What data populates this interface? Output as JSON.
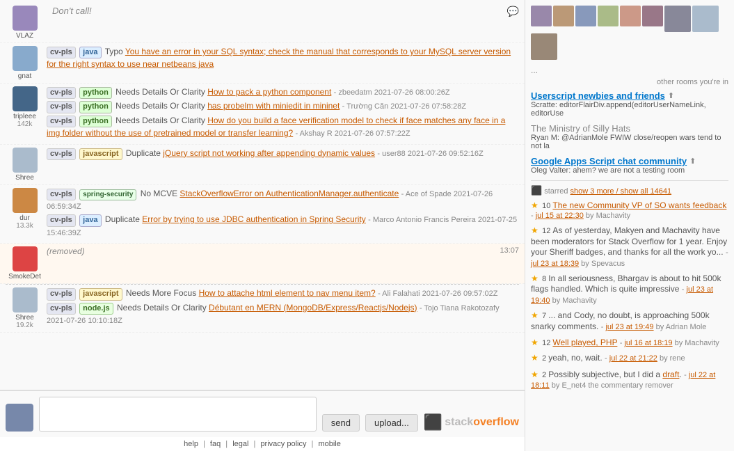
{
  "users": {
    "vlaz": {
      "name": "VLAZ",
      "status": "Don't call!"
    },
    "gnat": {
      "name": "gnat",
      "avatar_color": "#88aacc"
    },
    "tripleee": {
      "name": "tripleee",
      "rep": "142k",
      "avatar_color": "#446688"
    },
    "shree": {
      "name": "Shree",
      "avatar_color": "#aabbcc"
    },
    "dur": {
      "name": "dur",
      "rep": "13.3k",
      "avatar_color": "#cc8844"
    },
    "smokedet": {
      "name": "SmokeDet",
      "avatar_color": "#dd4444"
    },
    "shree2": {
      "name": "Shree",
      "rep": "19.2k",
      "avatar_color": "#aabbcc"
    }
  },
  "messages": [
    {
      "id": "m1",
      "user": "gnat",
      "tags": [
        {
          "type": "cvpls",
          "label": "cv-pls"
        },
        {
          "type": "java",
          "label": "java"
        }
      ],
      "reason": "Typo",
      "link_text": "You have an error in your SQL syntax; check the manual that corresponds to your MySQL server version for the right syntax to use near netbeans java",
      "link_url": "#",
      "meta": ""
    },
    {
      "id": "m2",
      "user": "tripleee",
      "tags": [
        {
          "type": "cvpls",
          "label": "cv-pls"
        },
        {
          "type": "python",
          "label": "python"
        }
      ],
      "reason": "Needs Details Or Clarity",
      "link_text": "How to pack a python component",
      "link_url": "#",
      "meta": "- zbeedatm 2021-07-26 08:00:26Z"
    },
    {
      "id": "m3",
      "user": "tripleee",
      "tags": [
        {
          "type": "cvpls",
          "label": "cv-pls"
        },
        {
          "type": "python",
          "label": "python"
        }
      ],
      "reason": "Needs Details Or Clarity",
      "link_text": "has probelm with miniedit in mininet",
      "link_url": "#",
      "meta": "- Trường Căn 2021-07-26 07:58:28Z"
    },
    {
      "id": "m4",
      "user": "tripleee",
      "tags": [
        {
          "type": "cvpls",
          "label": "cv-pls"
        },
        {
          "type": "python",
          "label": "python"
        }
      ],
      "reason": "Needs Details Or Clarity",
      "link_text": "How do you build a face verification model to check if face matches any face in a img folder without the use of pretrained model or transfer learning?",
      "link_url": "#",
      "meta": "- Akshay R 2021-07-26 07:57:22Z"
    },
    {
      "id": "m5",
      "user": "shree",
      "tags": [
        {
          "type": "cvpls",
          "label": "cv-pls"
        },
        {
          "type": "javascript",
          "label": "javascript"
        }
      ],
      "reason": "Duplicate",
      "link_text": "jQuery script not working after appending dynamic values",
      "link_url": "#",
      "meta": "- user88 2021-07-26 09:52:16Z"
    },
    {
      "id": "m6",
      "user": "dur",
      "tags": [
        {
          "type": "cvpls",
          "label": "cv-pls"
        },
        {
          "type": "spring",
          "label": "spring-security"
        }
      ],
      "reason": "No MCVE",
      "link_text": "StackOverflowError on AuthenticationManager.authenticate",
      "link_url": "#",
      "meta": "- Ace of Spade 2021-07-26 06:59:34Z"
    },
    {
      "id": "m7",
      "user": "dur",
      "tags": [
        {
          "type": "cvpls",
          "label": "cv-pls"
        },
        {
          "type": "java",
          "label": "java"
        }
      ],
      "reason": "Duplicate",
      "link_text": "Error by trying to use JDBC authentication in Spring Security",
      "link_url": "#",
      "meta": "- Marco Antonio Francis Pereira 2021-07-25 15:46:39Z"
    },
    {
      "id": "m8",
      "user": "smokedet",
      "removed": true,
      "removed_label": "(removed)",
      "time": "13:07"
    },
    {
      "id": "m9",
      "user": "shree2",
      "tags": [
        {
          "type": "cvpls",
          "label": "cv-pls"
        },
        {
          "type": "javascript",
          "label": "javascript"
        }
      ],
      "reason": "Needs More Focus",
      "link_text": "How to attache html element to nav menu item?",
      "link_url": "#",
      "meta": "- Ali Falahati 2021-07-26 09:57:02Z"
    },
    {
      "id": "m10",
      "user": "shree2",
      "tags": [
        {
          "type": "cvpls",
          "label": "cv-pls"
        },
        {
          "type": "nodejs",
          "label": "node.js"
        }
      ],
      "reason": "Needs Details Or Clarity",
      "link_text": "Débutant en MERN (MongoDB/Express/Reactjs/Nodejs)",
      "link_url": "#",
      "meta": "- Tojo Tiana Rakotozafy 2021-07-26 10:10:18Z"
    }
  ],
  "sidebar": {
    "ellipsis": "...",
    "other_rooms_label": "other rooms you're in",
    "rooms": [
      {
        "name": "Userscript newbies and friends",
        "has_expand": true,
        "desc": "Scratte: editorFlairDiv.append(editorUserNameLink, editorUse"
      },
      {
        "name": "The Ministry of Silly Hats",
        "has_expand": false,
        "desc": "Ryan M: @AdrianMole FWIW close/reopen wars tend to not la"
      },
      {
        "name": "Google Apps Script chat community",
        "has_expand": true,
        "desc": "Oleg Valter: ahem? we are not a testing room"
      }
    ],
    "starred": {
      "label": "starred",
      "show_more": "show 3 more / show all 14641",
      "items": [
        {
          "count": "10",
          "text": "The new Community VP of SO wants feedback",
          "meta": "jul 15 at 22:30 by Machavity"
        },
        {
          "count": "12",
          "text": "As of yesterday, Makyen and Machavity have been moderators for Stack Overflow for 1 year. Enjoy your Sheriff badges, and thanks for all the work yo...",
          "meta": "jul 23 at 18:39 by Spevacus"
        },
        {
          "count": "8",
          "text": "In all seriousness, Bhargav is about to hit 500k flags handled. Which is quite impressive",
          "meta": "jul 23 at 19:40 by Machavity"
        },
        {
          "count": "7",
          "text": "... and Cody, no doubt, is approaching 500k snarky comments.",
          "meta": "jul 23 at 19:49 by Adrian Mole"
        },
        {
          "count": "12",
          "text": "Well played, PHP",
          "meta": "jul 16 at 18:19 by Machavity"
        },
        {
          "count": "2",
          "text": "yeah, no, wait.",
          "meta": "jul 22 at 21:22 by rene"
        },
        {
          "count": "2",
          "text": "Possibly subjective, but I did a draft.",
          "meta": "jul 22 at 18:11 by E_net4 the commentary remover"
        }
      ]
    }
  },
  "input_area": {
    "placeholder": "",
    "send_label": "send",
    "upload_label": "upload...",
    "footer_links": [
      "help",
      "faq",
      "legal",
      "privacy policy",
      "mobile"
    ]
  },
  "so_logo": {
    "prefix": "stack",
    "suffix": "overflow"
  }
}
